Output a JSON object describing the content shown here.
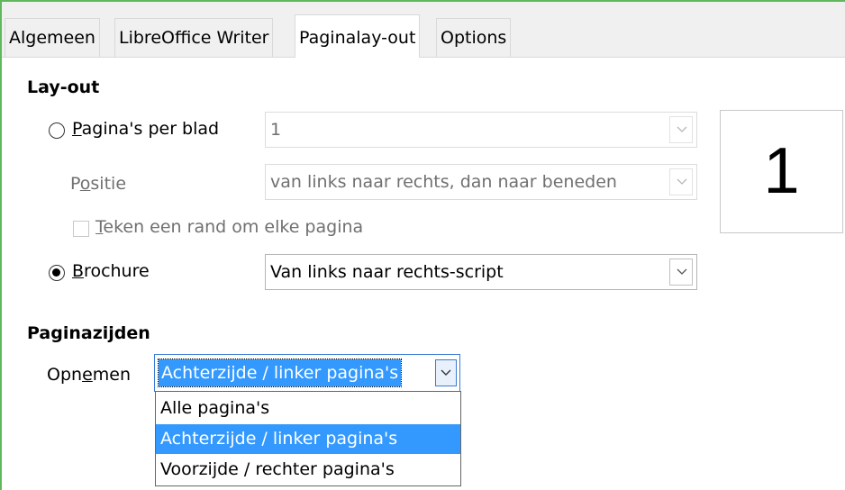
{
  "tabs": [
    "Algemeen",
    "LibreOffice Writer",
    "Paginalay-out",
    "Options"
  ],
  "active_tab": "Paginalay-out",
  "layout": {
    "title": "Lay-out",
    "pages_per_sheet": {
      "label_mnemonic": "P",
      "label_rest": "agina's per blad",
      "selected": false,
      "value": "1",
      "enabled": false
    },
    "position": {
      "label_pre": "P",
      "label_mnemonic": "o",
      "label_rest": "sitie",
      "value": "van links naar rechts, dan naar beneden",
      "enabled": false
    },
    "border": {
      "label_mnemonic": "T",
      "label_rest": "eken een rand om elke pagina",
      "checked": false,
      "enabled": false
    },
    "brochure": {
      "label_mnemonic": "B",
      "label_rest": "rochure",
      "selected": true,
      "value": "Van links naar rechts-script"
    },
    "preview_number": "1"
  },
  "page_sides": {
    "title": "Paginazijden",
    "include": {
      "label_pre": "Opn",
      "label_mnemonic": "e",
      "label_rest": "men",
      "value": "Achterzijde / linker pagina's",
      "options": [
        "Alle pagina's",
        "Achterzijde / linker pagina's",
        "Voorzijde / rechter pagina's"
      ],
      "highlighted_option": "Achterzijde / linker pagina's",
      "expanded": true
    }
  },
  "colors": {
    "highlight": "#3399ff",
    "window_border": "#5fb85c",
    "disabled_text": "#707070"
  }
}
